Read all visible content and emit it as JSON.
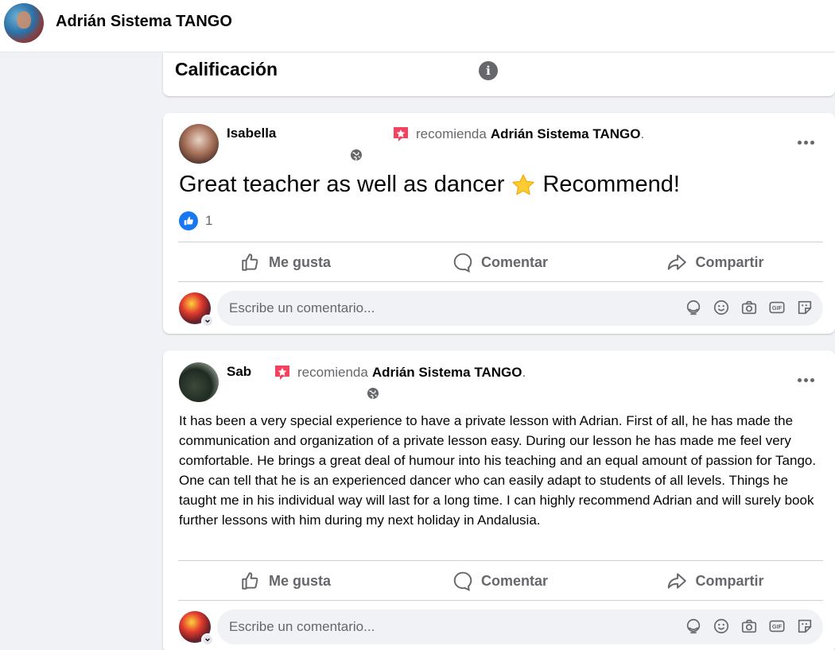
{
  "header": {
    "page_name": "Adrián Sistema TANGO"
  },
  "rating": {
    "title": "Calificación"
  },
  "reviews": [
    {
      "author": "Isabella",
      "verb": "recomienda",
      "target": "Adrián Sistema TANGO",
      "punct": ".",
      "text": "Great teacher as well as dancer",
      "text_after": "Recommend!",
      "like_count": "1",
      "actions": {
        "like": "Me gusta",
        "comment": "Comentar",
        "share": "Compartir"
      },
      "comment_placeholder": "Escribe un comentario..."
    },
    {
      "author": "Sab",
      "verb": "recomienda",
      "target": "Adrián Sistema TANGO",
      "punct": ".",
      "text": "It has been a very special experience to have a private lesson with Adrian. First of all, he has made the communication and organization of a private lesson easy. During our lesson he has made me feel very comfortable. He brings a great deal of humour into his teaching and an equal amount of passion for Tango. One can tell that he is an experienced dancer who can easily adapt to students of all levels. Things he taught me in his individual way will last for a long time. I can highly recommend Adrian and will surely book further lessons with him during my next holiday in Andalusia.",
      "actions": {
        "like": "Me gusta",
        "comment": "Comentar",
        "share": "Compartir"
      },
      "comment_placeholder": "Escribe un comentario..."
    }
  ],
  "icons": {
    "info": "i",
    "accent": "#1877f2",
    "recommend_color": "#f3425f"
  }
}
